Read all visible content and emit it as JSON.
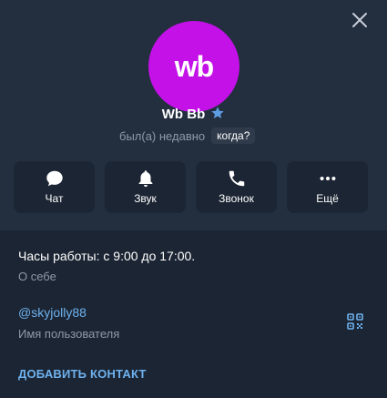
{
  "avatar": {
    "text": "wb",
    "color": "#c311e8"
  },
  "profile": {
    "name": "Wb Bb",
    "status": "был(а) недавно",
    "when_badge": "когда?"
  },
  "actions": [
    {
      "label": "Чат",
      "icon": "chat-bubble-icon"
    },
    {
      "label": "Звук",
      "icon": "bell-icon"
    },
    {
      "label": "Звонок",
      "icon": "phone-icon"
    },
    {
      "label": "Ещё",
      "icon": "more-dots-icon"
    }
  ],
  "info": {
    "hours": "Часы работы: с 9:00 до 17:00.",
    "hours_label": "О себе",
    "username": "@skyjolly88",
    "username_label": "Имя пользователя",
    "add_contact": "ДОБАВИТЬ КОНТАКТ"
  },
  "colors": {
    "header_bg": "#232f3f",
    "body_bg": "#1c2533",
    "accent": "#6eb2ef",
    "muted": "#8e9aa9",
    "star": "#5f9ee3"
  }
}
